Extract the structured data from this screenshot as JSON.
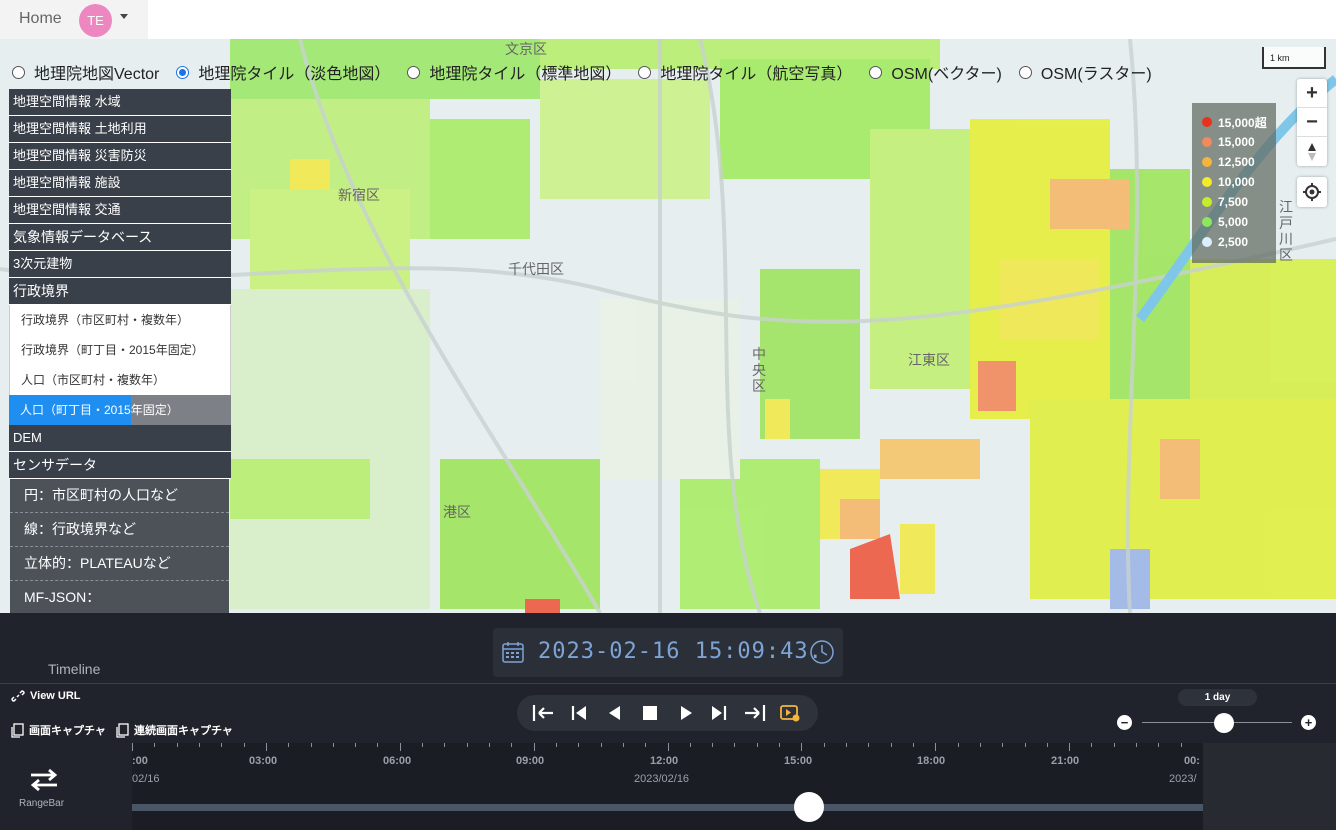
{
  "nav": {
    "home": "Home",
    "avatar": "TE"
  },
  "map": {
    "base_layers": [
      {
        "label": "地理院地図Vector",
        "checked": false
      },
      {
        "label": "地理院タイル（淡色地図）",
        "checked": true
      },
      {
        "label": "地理院タイル（標準地図）",
        "checked": false
      },
      {
        "label": "地理院タイル（航空写真）",
        "checked": false
      },
      {
        "label": "OSM(ベクター)",
        "checked": false
      },
      {
        "label": "OSM(ラスター)",
        "checked": false
      }
    ],
    "scale_label": "1 km",
    "labels": {
      "bunkyo": "文京区",
      "shinjuku": "新宿区",
      "chiyoda": "千代田区",
      "chuo": "中央区",
      "koto": "江東区",
      "minato": "港区",
      "edogawa": "江戸川区"
    },
    "zoom_in": "+",
    "zoom_out": "−"
  },
  "menu": {
    "items": [
      "地理空間情報 水域",
      "地理空間情報 土地利用",
      "地理空間情報 災害防災",
      "地理空間情報 施設",
      "地理空間情報 交通",
      "気象情報データベース",
      "3次元建物",
      "行政境界"
    ],
    "subitems": [
      "行政境界（市区町村・複数年）",
      "行政境界（町丁目・2015年固定）",
      "人口（市区町村・複数年）"
    ],
    "selected_sub": "人口（町丁目・2015年固定）",
    "after": [
      "DEM",
      "センサデータ"
    ],
    "circle_items": [
      "円：市区町村の人口など",
      "線：行政境界など",
      "立体的：PLATEAUなど",
      "MF-JSON："
    ]
  },
  "legend": [
    {
      "label": "15,000超",
      "color": "#e8321c"
    },
    {
      "label": "15,000",
      "color": "#f28a5c"
    },
    {
      "label": "12,500",
      "color": "#f5b43c"
    },
    {
      "label": "10,000",
      "color": "#f2ea2a"
    },
    {
      "label": "7,500",
      "color": "#c8ec2a"
    },
    {
      "label": "5,000",
      "color": "#8ee65a"
    },
    {
      "label": "2,500",
      "color": "#ddeeff"
    }
  ],
  "timeline": {
    "label": "Timeline",
    "clock": "2023-02-16 15:09:43.",
    "view_url": "View URL",
    "capture": "画面キャプチャ",
    "continuous_capture": "連続画面キャプチャ",
    "zoom_label": "1 day",
    "rangebar": "RangeBar",
    "times": [
      ":00",
      "03:00",
      "06:00",
      "09:00",
      "12:00",
      "15:00",
      "18:00",
      "21:00",
      "00:"
    ],
    "dates": [
      "02/16",
      "2023/02/16",
      "2023/"
    ],
    "progress": 0.632
  }
}
